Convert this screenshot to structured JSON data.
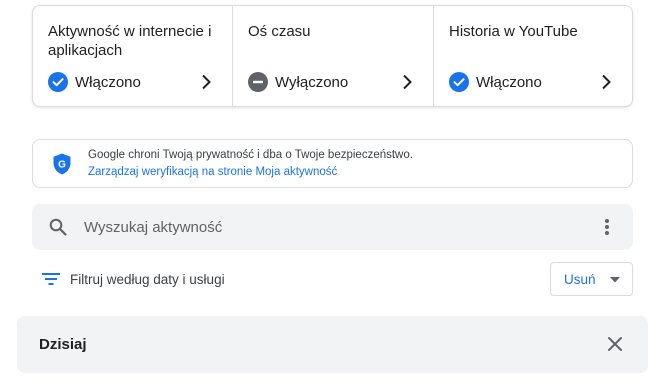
{
  "activity_cards": [
    {
      "title": "Aktywność w internecie i aplikacjach",
      "status": "Włączono",
      "status_icon": "check-circle-icon",
      "status_color": "#1a73e8"
    },
    {
      "title": "Oś czasu",
      "status": "Wyłączono",
      "status_icon": "minus-circle-icon",
      "status_color": "#5f6368"
    },
    {
      "title": "Historia w YouTube",
      "status": "Włączono",
      "status_icon": "check-circle-icon",
      "status_color": "#1a73e8"
    }
  ],
  "security_notice": {
    "text": "Google chroni Twoją prywatność i dba o Twoje bezpieczeństwo.",
    "link": "Zarządzaj weryfikacją na stronie Moja aktywność",
    "icon": "shield-icon"
  },
  "search": {
    "placeholder": "Wyszukaj aktywność",
    "value": ""
  },
  "filter": {
    "label": "Filtruj według daty i usługi"
  },
  "delete_button": {
    "label": "Usuń"
  },
  "section": {
    "title": "Dzisiaj"
  },
  "colors": {
    "accent": "#1a73e8",
    "surface": "#f1f3f4",
    "border": "#dadce0"
  }
}
